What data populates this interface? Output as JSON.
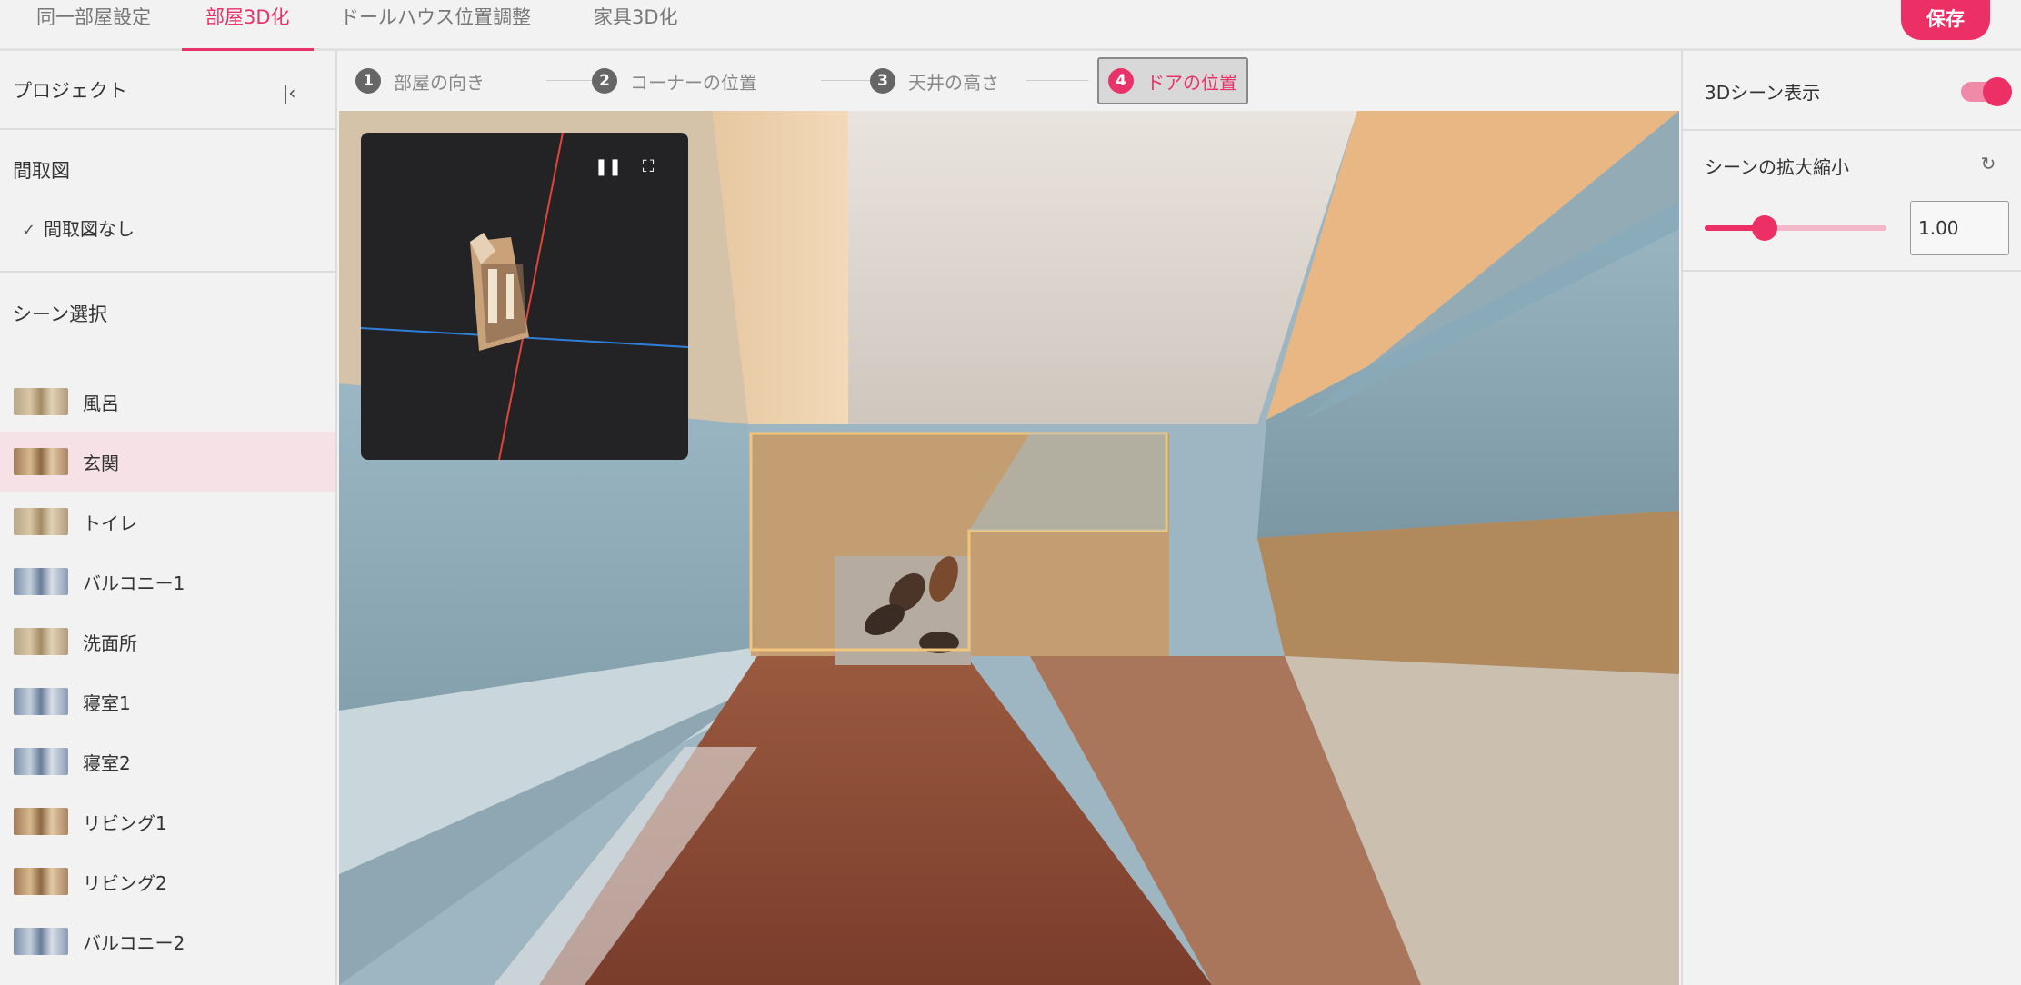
{
  "tabs": [
    {
      "label": "同一部屋設定",
      "active": false
    },
    {
      "label": "部屋3D化",
      "active": true
    },
    {
      "label": "ドールハウス位置調整",
      "active": false
    },
    {
      "label": "家具3D化",
      "active": false
    }
  ],
  "save_label": "保存",
  "sidebar": {
    "project_title": "プロジェクト",
    "floorplan_title": "間取図",
    "floorplan_item": "間取図なし",
    "scene_title": "シーン選択",
    "scenes": [
      {
        "label": "風呂",
        "selected": false
      },
      {
        "label": "玄関",
        "selected": true
      },
      {
        "label": "トイレ",
        "selected": false
      },
      {
        "label": "バルコニー1",
        "selected": false
      },
      {
        "label": "洗面所",
        "selected": false
      },
      {
        "label": "寝室1",
        "selected": false
      },
      {
        "label": "寝室2",
        "selected": false
      },
      {
        "label": "リビング1",
        "selected": false
      },
      {
        "label": "リビング2",
        "selected": false
      },
      {
        "label": "バルコニー2",
        "selected": false
      }
    ]
  },
  "steps": [
    {
      "num": "1",
      "label": "部屋の向き"
    },
    {
      "num": "2",
      "label": "コーナーの位置"
    },
    {
      "num": "3",
      "label": "天井の高さ"
    },
    {
      "num": "4",
      "label": "ドアの位置"
    }
  ],
  "right_panel": {
    "scene_display_label": "3Dシーン表示",
    "scene_display_on": true,
    "scale_label": "シーンの拡大縮小",
    "scale_value": "1.00",
    "scale_fraction": 0.33
  },
  "colors": {
    "accent": "#ec2f64"
  }
}
